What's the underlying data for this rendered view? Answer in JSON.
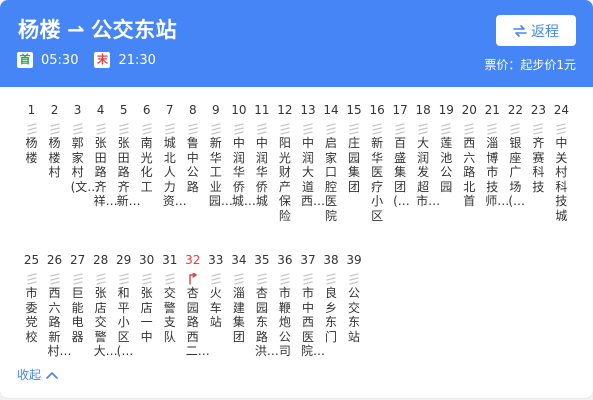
{
  "header": {
    "origin": "杨楼",
    "arrow": "⇀",
    "destination": "公交东站",
    "first_tag": "首",
    "first_time": "05:30",
    "last_tag": "末",
    "last_time": "21:30",
    "return_button": "返程",
    "fare": "票价：起步价1元"
  },
  "colors": {
    "brand": "#4585f5",
    "current": "#e04141",
    "first_tag": "#2ca65b"
  },
  "current_stop": 32,
  "stops": [
    {
      "num": "1",
      "name": "杨楼"
    },
    {
      "num": "2",
      "name": "杨楼村"
    },
    {
      "num": "3",
      "name": "郭家村(文…"
    },
    {
      "num": "4",
      "name": "张田路齐祥…"
    },
    {
      "num": "5",
      "name": "张田路齐新…"
    },
    {
      "num": "6",
      "name": "南光化工"
    },
    {
      "num": "7",
      "name": "城北人力资…"
    },
    {
      "num": "8",
      "name": "鲁中公路"
    },
    {
      "num": "9",
      "name": "新华工业园…"
    },
    {
      "num": "10",
      "name": "中润华侨城…"
    },
    {
      "num": "11",
      "name": "中润华侨城"
    },
    {
      "num": "12",
      "name": "阳光财产保险"
    },
    {
      "num": "13",
      "name": "中润大道西…"
    },
    {
      "num": "14",
      "name": "启家口腔医院"
    },
    {
      "num": "15",
      "name": "庄园集团"
    },
    {
      "num": "16",
      "name": "新华医疗小区"
    },
    {
      "num": "17",
      "name": "百盛集团(…"
    },
    {
      "num": "18",
      "name": "大润发超市…"
    },
    {
      "num": "19",
      "name": "莲池公园"
    },
    {
      "num": "20",
      "name": "西六路北首"
    },
    {
      "num": "21",
      "name": "淄博市技师…"
    },
    {
      "num": "22",
      "name": "银座广场(…"
    },
    {
      "num": "23",
      "name": "齐赛科技"
    },
    {
      "num": "24",
      "name": "中关村科技城"
    },
    {
      "num": "25",
      "name": "市委党校"
    },
    {
      "num": "26",
      "name": "西六路新村…"
    },
    {
      "num": "27",
      "name": "巨能电器"
    },
    {
      "num": "28",
      "name": "张店交警大…"
    },
    {
      "num": "29",
      "name": "和平小区(…"
    },
    {
      "num": "30",
      "name": "张店一中"
    },
    {
      "num": "31",
      "name": "交警支队"
    },
    {
      "num": "32",
      "name": "杏园路西二…"
    },
    {
      "num": "33",
      "name": "火车站"
    },
    {
      "num": "34",
      "name": "淄建集团"
    },
    {
      "num": "35",
      "name": "杏园东路洪…"
    },
    {
      "num": "36",
      "name": "市鞭炮公司"
    },
    {
      "num": "37",
      "name": "市中西医院…"
    },
    {
      "num": "38",
      "name": "良乡东门"
    },
    {
      "num": "39",
      "name": "公交东站"
    }
  ],
  "collapse_label": "收起"
}
